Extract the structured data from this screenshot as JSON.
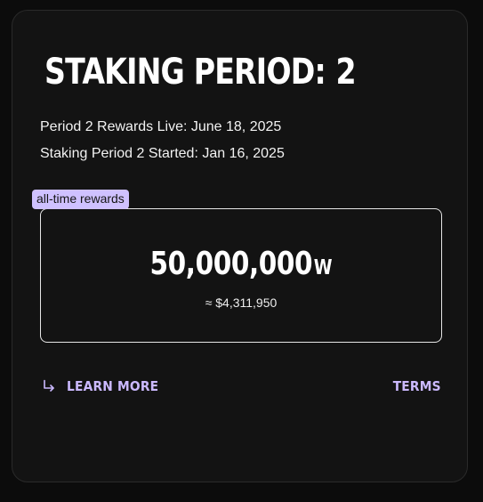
{
  "staking": {
    "title_label": "STAKING PERIOD:",
    "period_number": "2",
    "rewards_live": "Period 2 Rewards Live: June 18, 2025",
    "period_started": "Staking Period 2 Started: Jan 16, 2025"
  },
  "rewards": {
    "tag_label": "all-time rewards",
    "amount": "50,000,000",
    "unit": "W",
    "usd_value": "≈ $4,311,950"
  },
  "links": {
    "learn_more_icon": "arrow-down-right-icon",
    "learn_more_label": "LEARN MORE",
    "terms_label": "TERMS"
  },
  "colors": {
    "background": "#0c0c0c",
    "card": "#131313",
    "accent": "#cbb9ff",
    "tag_background": "#cfc1ff",
    "text": "#ffffff"
  }
}
